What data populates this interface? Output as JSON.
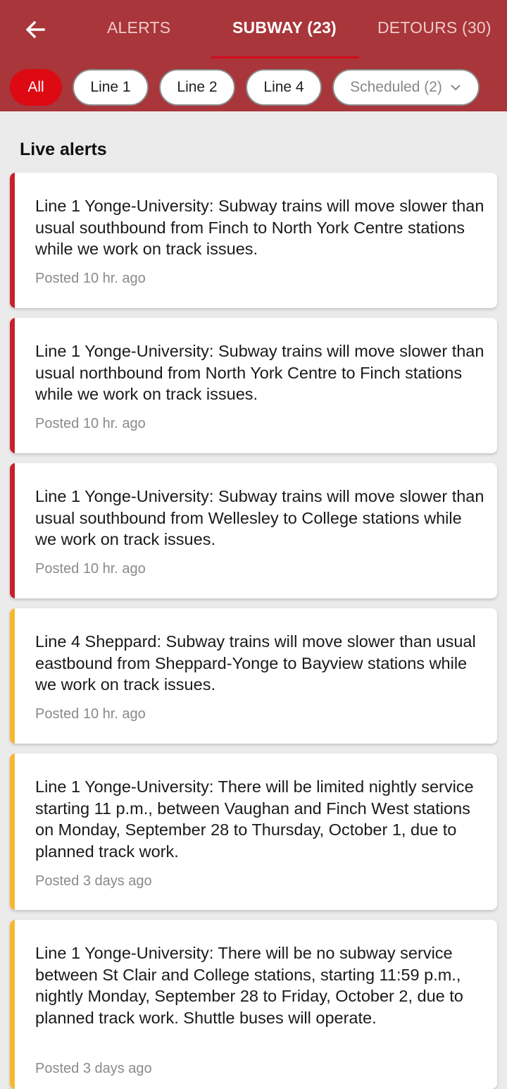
{
  "header": {
    "tabs": [
      {
        "label": "ALERTS"
      },
      {
        "label": "SUBWAY (23)"
      },
      {
        "label": "DETOURS (30)"
      }
    ],
    "active_tab": "SUBWAY (23)"
  },
  "filters": {
    "chips": [
      {
        "label": "All"
      },
      {
        "label": "Line 1"
      },
      {
        "label": "Line 2"
      },
      {
        "label": "Line 4"
      },
      {
        "label": "Scheduled (2)"
      }
    ],
    "selected": "All"
  },
  "section": {
    "title": "Live alerts"
  },
  "colors": {
    "header": "#a8363a",
    "selected_chip": "#dd0a14",
    "line1": "#c8202a",
    "line4": "#f7b731"
  },
  "alerts": [
    {
      "text": "Line 1 Yonge-University: Subway trains will move slower than usual southbound from Finch to North York Centre stations while we work on track issues.",
      "posted": "Posted 10 hr. ago",
      "color": "#c8202a"
    },
    {
      "text": "Line 1 Yonge-University: Subway trains will move slower than usual northbound from North York Centre to Finch stations while we work on track issues.",
      "posted": "Posted 10 hr. ago",
      "color": "#c8202a"
    },
    {
      "text": "Line 1 Yonge-University: Subway trains will move slower than usual southbound from Wellesley to College stations while we work on track issues.",
      "posted": "Posted 10 hr. ago",
      "color": "#c8202a"
    },
    {
      "text": "Line 4 Sheppard: Subway trains will move slower than usual eastbound from Sheppard-Yonge to Bayview stations while we work on track issues.",
      "posted": "Posted 10 hr. ago",
      "color": "#f7b731"
    },
    {
      "text": "Line 1 Yonge-University: There will be limited nightly service starting 11 p.m., between Vaughan and Finch West stations on Monday, September 28 to Thursday, October 1, due to planned track work.",
      "posted": "Posted 3 days ago",
      "color": "#f7b731"
    },
    {
      "text": "Line 1 Yonge-University: There will be no subway service between St Clair and College stations, starting 11:59 p.m., nightly Monday, September 28 to Friday, October 2, due to planned track work. Shuttle buses will operate.",
      "posted": "Posted 3 days ago",
      "color": "#f7b731"
    }
  ]
}
